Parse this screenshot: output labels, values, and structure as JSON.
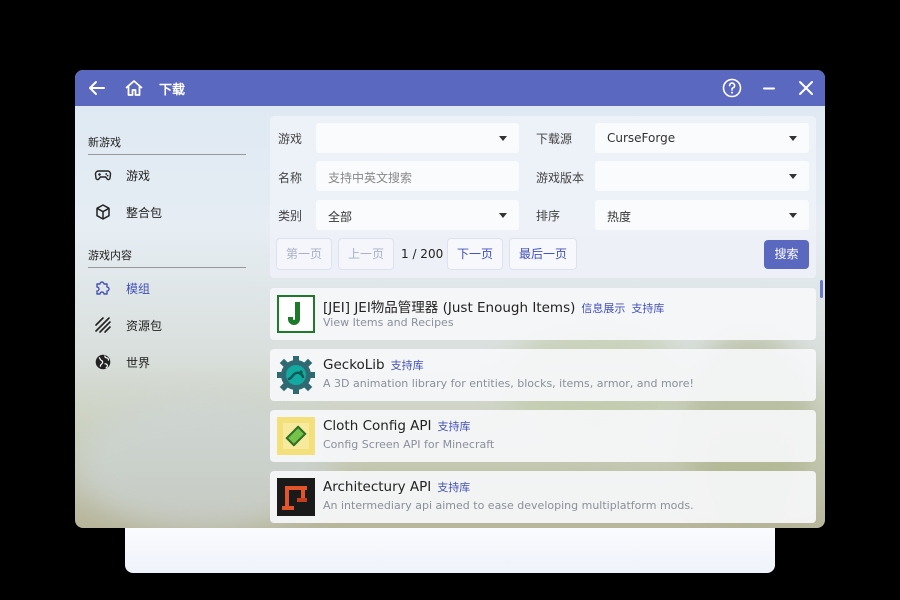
{
  "window": {
    "title": "下载"
  },
  "titlebar": {
    "back_icon": "arrow-left-icon",
    "home_icon": "home-icon",
    "help_icon": "help-circle-icon",
    "minimize_icon": "minimize-icon",
    "close_icon": "close-icon"
  },
  "sidebar": {
    "sections": [
      {
        "heading": "新游戏",
        "items": [
          {
            "label": "游戏",
            "icon": "gamepad-icon"
          },
          {
            "label": "整合包",
            "icon": "package-icon"
          }
        ]
      },
      {
        "heading": "游戏内容",
        "items": [
          {
            "label": "模组",
            "icon": "puzzle-icon",
            "active": true
          },
          {
            "label": "资源包",
            "icon": "texture-icon"
          },
          {
            "label": "世界",
            "icon": "globe-icon"
          }
        ]
      }
    ]
  },
  "filters": {
    "game": {
      "label": "游戏",
      "value": ""
    },
    "source": {
      "label": "下载源",
      "value": "CurseForge"
    },
    "name": {
      "label": "名称",
      "placeholder": "支持中英文搜索"
    },
    "game_version": {
      "label": "游戏版本",
      "value": ""
    },
    "category": {
      "label": "类别",
      "value": "全部"
    },
    "sort": {
      "label": "排序",
      "value": "热度"
    }
  },
  "pagination": {
    "first": "第一页",
    "prev": "上一页",
    "info": "1 / 200",
    "next": "下一页",
    "last": "最后一页"
  },
  "search_button": "搜索",
  "results": [
    {
      "title": "[JEI] JEI物品管理器 (Just Enough Items)",
      "tags": [
        "信息展示",
        "支持库"
      ],
      "desc": "View Items and Recipes",
      "icon": "jei-logo-icon"
    },
    {
      "title": "GeckoLib",
      "tags": [
        "支持库"
      ],
      "desc": "A 3D animation library for entities, blocks, items, armor, and more!",
      "icon": "geckolib-logo-icon"
    },
    {
      "title": "Cloth Config API",
      "tags": [
        "支持库"
      ],
      "desc": "Config Screen API for Minecraft",
      "icon": "cloth-config-logo-icon"
    },
    {
      "title": "Architectury API",
      "tags": [
        "支持库"
      ],
      "desc": "An intermediary api aimed to ease developing multiplatform mods.",
      "icon": "architectury-logo-icon"
    }
  ],
  "colors": {
    "accent": "#5b68c0",
    "link": "#4250b8"
  }
}
